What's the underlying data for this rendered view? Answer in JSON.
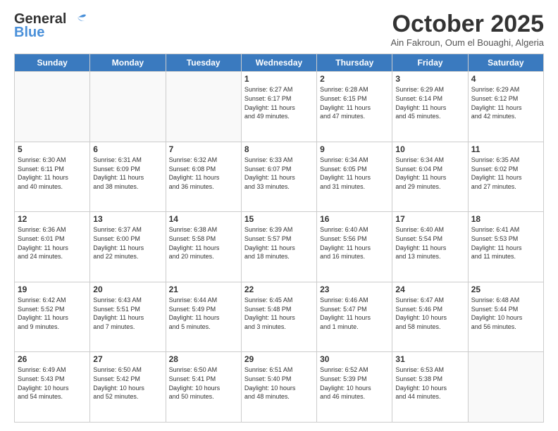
{
  "header": {
    "logo_line1": "General",
    "logo_line2": "Blue",
    "month": "October 2025",
    "location": "Ain Fakroun, Oum el Bouaghi, Algeria"
  },
  "days_of_week": [
    "Sunday",
    "Monday",
    "Tuesday",
    "Wednesday",
    "Thursday",
    "Friday",
    "Saturday"
  ],
  "weeks": [
    [
      {
        "day": "",
        "info": ""
      },
      {
        "day": "",
        "info": ""
      },
      {
        "day": "",
        "info": ""
      },
      {
        "day": "1",
        "info": "Sunrise: 6:27 AM\nSunset: 6:17 PM\nDaylight: 11 hours\nand 49 minutes."
      },
      {
        "day": "2",
        "info": "Sunrise: 6:28 AM\nSunset: 6:15 PM\nDaylight: 11 hours\nand 47 minutes."
      },
      {
        "day": "3",
        "info": "Sunrise: 6:29 AM\nSunset: 6:14 PM\nDaylight: 11 hours\nand 45 minutes."
      },
      {
        "day": "4",
        "info": "Sunrise: 6:29 AM\nSunset: 6:12 PM\nDaylight: 11 hours\nand 42 minutes."
      }
    ],
    [
      {
        "day": "5",
        "info": "Sunrise: 6:30 AM\nSunset: 6:11 PM\nDaylight: 11 hours\nand 40 minutes."
      },
      {
        "day": "6",
        "info": "Sunrise: 6:31 AM\nSunset: 6:09 PM\nDaylight: 11 hours\nand 38 minutes."
      },
      {
        "day": "7",
        "info": "Sunrise: 6:32 AM\nSunset: 6:08 PM\nDaylight: 11 hours\nand 36 minutes."
      },
      {
        "day": "8",
        "info": "Sunrise: 6:33 AM\nSunset: 6:07 PM\nDaylight: 11 hours\nand 33 minutes."
      },
      {
        "day": "9",
        "info": "Sunrise: 6:34 AM\nSunset: 6:05 PM\nDaylight: 11 hours\nand 31 minutes."
      },
      {
        "day": "10",
        "info": "Sunrise: 6:34 AM\nSunset: 6:04 PM\nDaylight: 11 hours\nand 29 minutes."
      },
      {
        "day": "11",
        "info": "Sunrise: 6:35 AM\nSunset: 6:02 PM\nDaylight: 11 hours\nand 27 minutes."
      }
    ],
    [
      {
        "day": "12",
        "info": "Sunrise: 6:36 AM\nSunset: 6:01 PM\nDaylight: 11 hours\nand 24 minutes."
      },
      {
        "day": "13",
        "info": "Sunrise: 6:37 AM\nSunset: 6:00 PM\nDaylight: 11 hours\nand 22 minutes."
      },
      {
        "day": "14",
        "info": "Sunrise: 6:38 AM\nSunset: 5:58 PM\nDaylight: 11 hours\nand 20 minutes."
      },
      {
        "day": "15",
        "info": "Sunrise: 6:39 AM\nSunset: 5:57 PM\nDaylight: 11 hours\nand 18 minutes."
      },
      {
        "day": "16",
        "info": "Sunrise: 6:40 AM\nSunset: 5:56 PM\nDaylight: 11 hours\nand 16 minutes."
      },
      {
        "day": "17",
        "info": "Sunrise: 6:40 AM\nSunset: 5:54 PM\nDaylight: 11 hours\nand 13 minutes."
      },
      {
        "day": "18",
        "info": "Sunrise: 6:41 AM\nSunset: 5:53 PM\nDaylight: 11 hours\nand 11 minutes."
      }
    ],
    [
      {
        "day": "19",
        "info": "Sunrise: 6:42 AM\nSunset: 5:52 PM\nDaylight: 11 hours\nand 9 minutes."
      },
      {
        "day": "20",
        "info": "Sunrise: 6:43 AM\nSunset: 5:51 PM\nDaylight: 11 hours\nand 7 minutes."
      },
      {
        "day": "21",
        "info": "Sunrise: 6:44 AM\nSunset: 5:49 PM\nDaylight: 11 hours\nand 5 minutes."
      },
      {
        "day": "22",
        "info": "Sunrise: 6:45 AM\nSunset: 5:48 PM\nDaylight: 11 hours\nand 3 minutes."
      },
      {
        "day": "23",
        "info": "Sunrise: 6:46 AM\nSunset: 5:47 PM\nDaylight: 11 hours\nand 1 minute."
      },
      {
        "day": "24",
        "info": "Sunrise: 6:47 AM\nSunset: 5:46 PM\nDaylight: 10 hours\nand 58 minutes."
      },
      {
        "day": "25",
        "info": "Sunrise: 6:48 AM\nSunset: 5:44 PM\nDaylight: 10 hours\nand 56 minutes."
      }
    ],
    [
      {
        "day": "26",
        "info": "Sunrise: 6:49 AM\nSunset: 5:43 PM\nDaylight: 10 hours\nand 54 minutes."
      },
      {
        "day": "27",
        "info": "Sunrise: 6:50 AM\nSunset: 5:42 PM\nDaylight: 10 hours\nand 52 minutes."
      },
      {
        "day": "28",
        "info": "Sunrise: 6:50 AM\nSunset: 5:41 PM\nDaylight: 10 hours\nand 50 minutes."
      },
      {
        "day": "29",
        "info": "Sunrise: 6:51 AM\nSunset: 5:40 PM\nDaylight: 10 hours\nand 48 minutes."
      },
      {
        "day": "30",
        "info": "Sunrise: 6:52 AM\nSunset: 5:39 PM\nDaylight: 10 hours\nand 46 minutes."
      },
      {
        "day": "31",
        "info": "Sunrise: 6:53 AM\nSunset: 5:38 PM\nDaylight: 10 hours\nand 44 minutes."
      },
      {
        "day": "",
        "info": ""
      }
    ]
  ]
}
